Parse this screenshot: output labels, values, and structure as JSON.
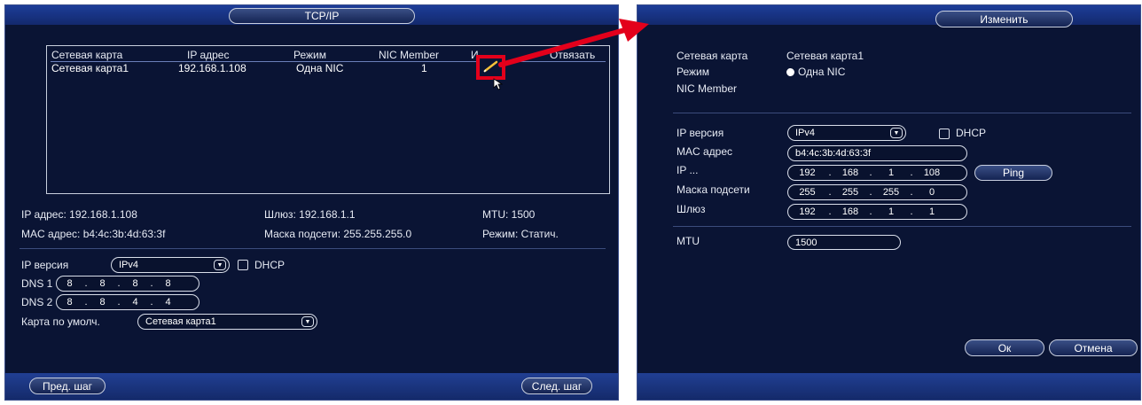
{
  "left": {
    "title": "TCP/IP",
    "table": {
      "headers": [
        "Сетевая карта",
        "IP адрес",
        "Режим",
        "NIC Member",
        "И",
        "Отвязать"
      ],
      "rows": [
        {
          "nic": "Сетевая карта1",
          "ip": "192.168.1.108",
          "mode": "Одна NIC",
          "member": "1"
        }
      ]
    },
    "info": {
      "ip": "IP адрес: 192.168.1.108",
      "gateway": "Шлюз: 192.168.1.1",
      "mtu": "MTU: 1500",
      "mac": "MAC адрес: b4:4c:3b:4d:63:3f",
      "mask": "Маска подсети: 255.255.255.0",
      "mode": "Режим: Статич."
    },
    "ip_version_label": "IP версия",
    "ip_version_value": "IPv4",
    "dhcp_label": "DHCP",
    "dns1_label": "DNS 1",
    "dns1": [
      "8",
      "8",
      "8",
      "8"
    ],
    "dns2_label": "DNS 2",
    "dns2": [
      "8",
      "8",
      "4",
      "4"
    ],
    "default_card_label": "Карта по умолч.",
    "default_card_value": "Сетевая карта1",
    "prev_label": "Пред. шаг",
    "next_label": "След. шаг"
  },
  "right": {
    "title": "Изменить",
    "nic_label": "Сетевая карта",
    "nic_value": "Сетевая карта1",
    "mode_label": "Режим",
    "mode_value": "Одна NIC",
    "member_label": "NIC Member",
    "ip_version_label": "IP версия",
    "ip_version_value": "IPv4",
    "dhcp_label": "DHCP",
    "mac_label": "MAC адрес",
    "mac_value": "b4:4c:3b:4d:63:3f",
    "ip_label": "IP ...",
    "ip": [
      "192",
      "168",
      "1",
      "108"
    ],
    "ping_label": "Ping",
    "mask_label": "Маска подсети",
    "mask": [
      "255",
      "255",
      "255",
      "0"
    ],
    "gateway_label": "Шлюз",
    "gateway": [
      "192",
      "168",
      "1",
      "1"
    ],
    "mtu_label": "MTU",
    "mtu_value": "1500",
    "ok_label": "Ок",
    "cancel_label": "Отмена"
  },
  "colors": {
    "panel_bg": "#0a1434",
    "bar": "#1a3688",
    "highlight": "#e3001b",
    "pen": "#f5c23a"
  },
  "icons": {
    "edit": "pencil-icon",
    "cursor": "mouse-cursor-icon",
    "annotation": "red-arrow-icon"
  }
}
